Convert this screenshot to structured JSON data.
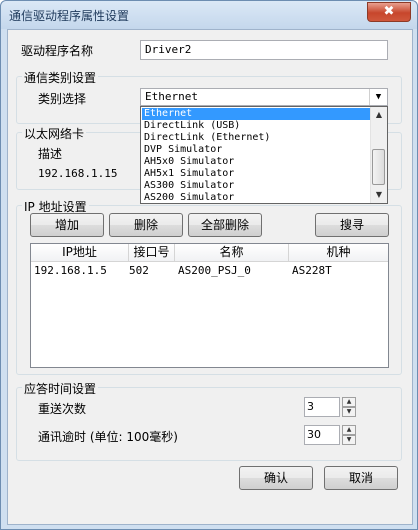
{
  "window": {
    "title": "通信驱动程序属性设置",
    "close_glyph": "✖"
  },
  "driver": {
    "label": "驱动程序名称",
    "value": "Driver2"
  },
  "comm": {
    "group_label": "通信类别设置",
    "select_label": "类别选择",
    "selected": "Ethernet",
    "options": [
      "Ethernet",
      "DirectLink (USB)",
      "DirectLink (Ethernet)",
      "DVP Simulator",
      "AH5x0 Simulator",
      "AH5x1 Simulator",
      "AS300 Simulator",
      "AS200 Simulator"
    ]
  },
  "ethernet": {
    "group_label": "以太网络卡",
    "desc_label": "描述",
    "ip": "192.168.1.15"
  },
  "ip": {
    "group_label": "IP 地址设置",
    "add_button": "增加",
    "delete_button": "删除",
    "delete_all_button": "全部删除",
    "search_button": "搜寻",
    "columns": [
      "IP地址",
      "接口号",
      "名称",
      "机种"
    ],
    "rows": [
      [
        "192.168.1.5",
        "502",
        "AS200_PSJ_0",
        "AS228T"
      ]
    ]
  },
  "timing": {
    "group_label": "应答时间设置",
    "retry_label": "重送次数",
    "retry_value": "3",
    "timeout_label": "通讯逾时 (单位: 100毫秒)",
    "timeout_value": "30"
  },
  "footer": {
    "ok_button": "确认",
    "cancel_button": "取消"
  },
  "icons": {
    "combo_arrow": "triangle-down",
    "scroll_up": "triangle-up",
    "scroll_down": "triangle-down",
    "spin_up": "triangle-up",
    "spin_down": "triangle-down"
  }
}
